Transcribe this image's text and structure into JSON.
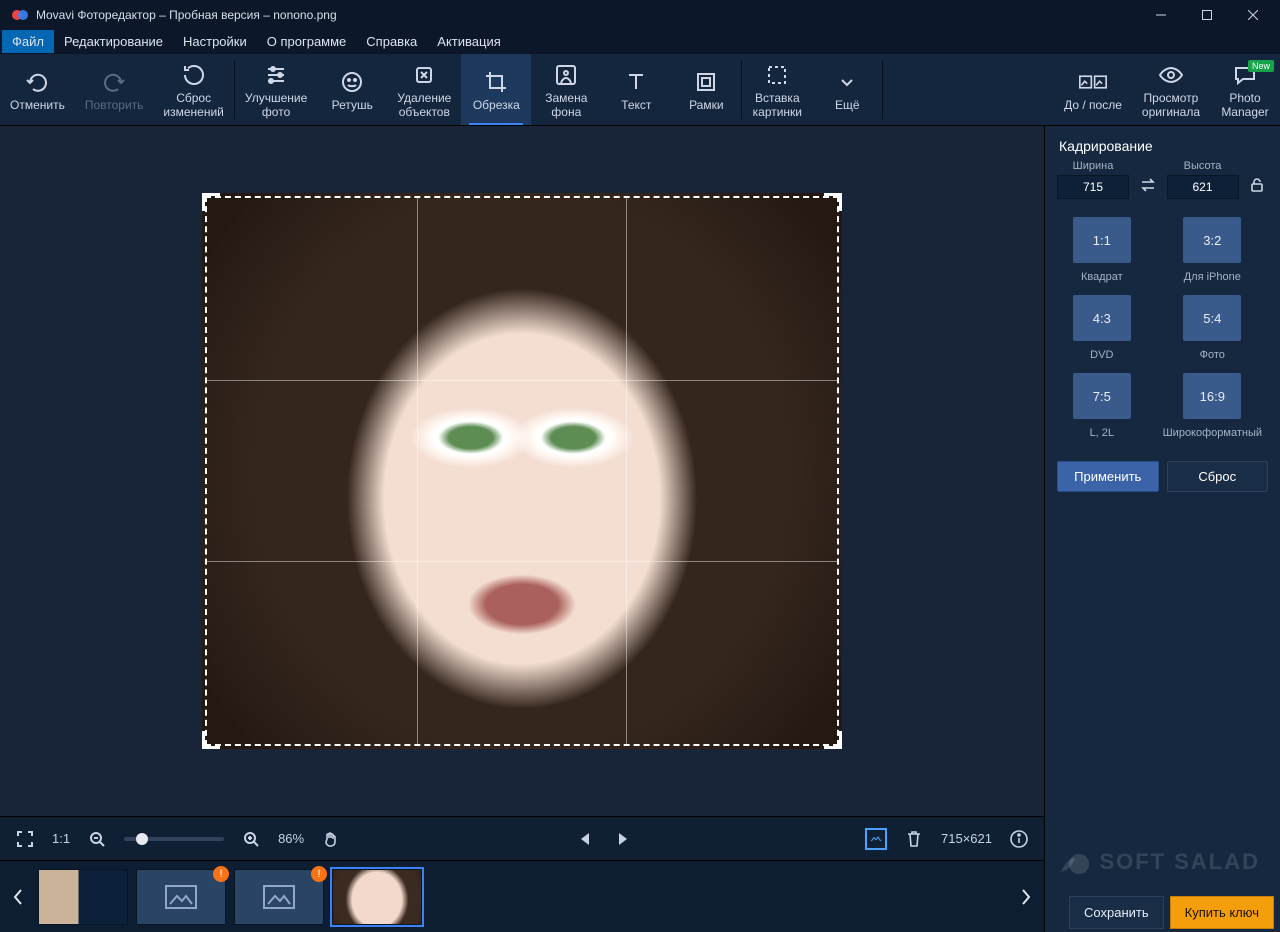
{
  "title": "Movavi Фоторедактор – Пробная версия – nonono.png",
  "menu": [
    "Файл",
    "Редактирование",
    "Настройки",
    "О программе",
    "Справка",
    "Активация"
  ],
  "toolbar": {
    "undo": "Отменить",
    "redo": "Повторить",
    "reset": "Сброс\nизменений",
    "enhance": "Улучшение\nфото",
    "retouch": "Ретушь",
    "removal": "Удаление\nобъектов",
    "crop": "Обрезка",
    "bg": "Замена\nфона",
    "text": "Текст",
    "frames": "Рамки",
    "insert": "Вставка\nкартинки",
    "more": "Ещё",
    "beforeafter": "До / после",
    "original": "Просмотр\nоригинала",
    "pm": "Photo\nManager",
    "new": "New"
  },
  "crop_panel": {
    "title": "Кадрирование",
    "width_label": "Ширина",
    "height_label": "Высота",
    "width": "715",
    "height": "621",
    "ratios": [
      {
        "r": "1:1",
        "l": "Квадрат"
      },
      {
        "r": "3:2",
        "l": "Для iPhone"
      },
      {
        "r": "4:3",
        "l": "DVD"
      },
      {
        "r": "5:4",
        "l": "Фото"
      },
      {
        "r": "7:5",
        "l": "L, 2L"
      },
      {
        "r": "16:9",
        "l": "Широкоформатный"
      }
    ],
    "apply": "Применить",
    "reset": "Сброс"
  },
  "status": {
    "fit": "1:1",
    "zoom": "86%",
    "dims": "715×621"
  },
  "footer": {
    "save": "Сохранить",
    "buy": "Купить ключ"
  },
  "watermark": "SOFT SALAD"
}
